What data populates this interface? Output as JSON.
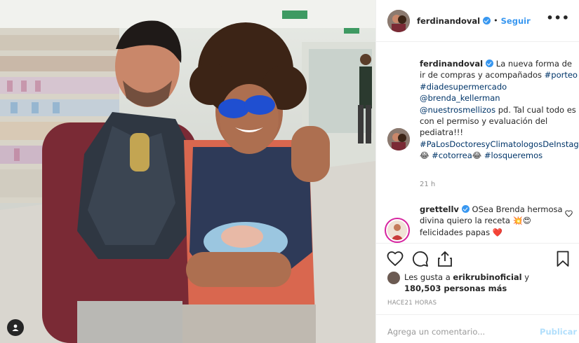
{
  "post": {
    "username": "ferdinandoval",
    "follow_label": "Seguir",
    "dot": "•",
    "more_label": "•••",
    "caption": {
      "username": "ferdinandoval",
      "line1": "La nueva forma de ir de compras y acompañados",
      "tag1": "#porteo",
      "tag2": "#diadesupermercado",
      "mention1": "@brenda_kellerman",
      "mention2": "@nuestrosmellizos",
      "text2": " pd. Tal cual todo es con el permiso y evaluación del pediatra!!!",
      "tag3": "#PaLosDoctoresyClimatologosDeInstagram",
      "emoji1": "😂",
      "tag4": "#cotorrea",
      "emoji2": "😂",
      "tag5": "#losqueremos",
      "time": "21 h"
    },
    "comment": {
      "username": "grettellv",
      "text": "OSea Brenda hermosa divina quiero la receta",
      "emojis": "💥😍",
      "text2": " felicidades papas ",
      "heart": "❤️"
    },
    "likes": {
      "prefix": "Les gusta a ",
      "user": "erikrubinoficial",
      "middle": " y ",
      "count": "180,503 personas más"
    },
    "posted": "HACE21 HORAS",
    "add_comment_placeholder": "Agrega un comentario...",
    "publish_label": "Publicar"
  },
  "colors": {
    "link": "#3897f0",
    "tag": "#003569",
    "muted": "#8e8e8e",
    "border": "#efefef"
  },
  "icons": [
    "heart-icon",
    "comment-icon",
    "share-icon",
    "bookmark-icon",
    "verified-icon",
    "user-tag-icon"
  ]
}
